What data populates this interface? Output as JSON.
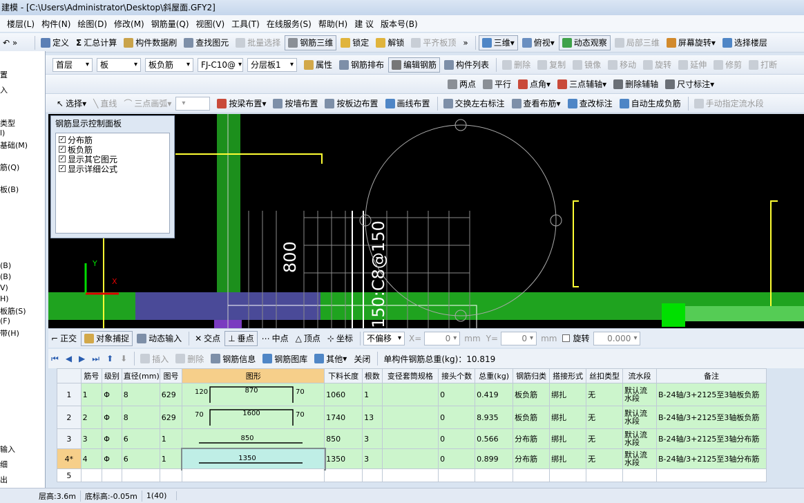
{
  "window": {
    "title": "建模 - [C:\\Users\\Administrator\\Desktop\\斜屋面.GFY2]"
  },
  "menu": [
    "楼层(L)",
    "构件(N)",
    "绘图(D)",
    "修改(M)",
    "钢筋量(Q)",
    "视图(V)",
    "工具(T)",
    "在线服务(S)",
    "帮助(H)",
    "建 议",
    "版本号(B)"
  ],
  "toolbar1": {
    "define": "定义",
    "summary": "汇总计算",
    "brush": "构件数据刷",
    "find": "查找图元",
    "batch": "批量选择",
    "rebar3d": "钢筋三维",
    "lock": "锁定",
    "unlock": "解锁",
    "align": "平齐板顶",
    "view3d": "三维",
    "top": "俯视",
    "dynamic": "动态观察",
    "local3d": "局部三维",
    "rotate": "屏幕旋转",
    "floor_select": "选择楼层"
  },
  "toolbar2": {
    "floor": "首层",
    "type": "板",
    "subtype": "板负筋",
    "component": "FJ-C10@",
    "layer": "分层板1",
    "attr": "属性",
    "arrange": "钢筋排布",
    "edit_rebar": "编辑钢筋",
    "comp_list": "构件列表",
    "delete": "删除",
    "copy": "复制",
    "mirror": "镜像",
    "move": "移动",
    "rotate": "旋转",
    "extend": "延伸",
    "trim": "修剪",
    "break": "打断"
  },
  "toolbar3": {
    "two_point": "两点",
    "parallel": "平行",
    "point_angle": "点角",
    "three_point_aux": "三点辅轴",
    "delete_aux": "删除辅轴",
    "dimension": "尺寸标注"
  },
  "toolbar4": {
    "select": "选择",
    "line": "直线",
    "arc3": "三点画弧",
    "by_beam": "按梁布置",
    "by_wall": "按墙布置",
    "by_slab_edge": "按板边布置",
    "draw_line": "画线布置",
    "swap_labels": "交换左右标注",
    "view_layout": "查看布筋",
    "check_labels": "查改标注",
    "auto_gen": "自动生成负筋",
    "flow_seg": "手动指定流水段"
  },
  "left_panel": {
    "rows": [
      "置",
      "入",
      "类型",
      "l)",
      "基础(M)",
      "筋(Q)",
      "板(B)",
      "(B)",
      "(B)",
      "V)",
      "H)",
      "板筋(S)",
      "(F)",
      "带(H)",
      "输入",
      "细",
      "出"
    ]
  },
  "rebar_panel": {
    "title": "钢筋显示控制面板",
    "options": [
      {
        "label": "分布筋",
        "checked": true
      },
      {
        "label": "板负筋",
        "checked": true
      },
      {
        "label": "显示其它图元",
        "checked": true
      },
      {
        "label": "显示详细公式",
        "checked": true
      }
    ]
  },
  "canvas": {
    "dim_label": "800",
    "rebar_label": "150:C8@150",
    "axis_x": "X",
    "axis_y": "Y"
  },
  "snap_bar": {
    "ortho": "正交",
    "object_snap": "对象捕捉",
    "dynamic_input": "动态输入",
    "intersection": "交点",
    "perpendicular": "垂点",
    "midpoint": "中点",
    "vertex": "顶点",
    "coordinate": "坐标",
    "offset_mode": "不偏移",
    "x_label": "X=",
    "x_value": "0",
    "x_unit": "mm",
    "y_label": "Y=",
    "y_value": "0",
    "y_unit": "mm",
    "rotate_label": "旋转",
    "rotate_value": "0.000"
  },
  "grid_toolbar": {
    "insert": "插入",
    "delete": "删除",
    "rebar_info": "钢筋信息",
    "rebar_library": "钢筋图库",
    "other": "其他",
    "close": "关闭",
    "total_weight": "单构件钢筋总重(kg)：10.819"
  },
  "table": {
    "headers": [
      "筋号",
      "级别",
      "直径(mm)",
      "图号",
      "图形",
      "下料长度",
      "根数",
      "变径套筒规格",
      "接头个数",
      "总重(kg)",
      "钢筋归类",
      "搭接形式",
      "丝扣类型",
      "流水段",
      "备注"
    ],
    "rows": [
      {
        "row_num": "1",
        "cells": [
          "1",
          "Φ",
          "8",
          "629",
          "",
          "1060",
          "1",
          "",
          "0",
          "0.419",
          "板负筋",
          "绑扎",
          "无",
          "默认流水段",
          "B-24轴/3+2125至3轴板负筋"
        ],
        "shape": {
          "left": "120",
          "mid": "870",
          "right": "70"
        }
      },
      {
        "row_num": "2",
        "cells": [
          "2",
          "Φ",
          "8",
          "629",
          "",
          "1740",
          "13",
          "",
          "0",
          "8.935",
          "板负筋",
          "绑扎",
          "无",
          "默认流水段",
          "B-24轴/3+2125至3轴板负筋"
        ],
        "shape": {
          "left": "70",
          "mid": "1600",
          "right": "70"
        }
      },
      {
        "row_num": "3",
        "cells": [
          "3",
          "Φ",
          "6",
          "1",
          "",
          "850",
          "3",
          "",
          "0",
          "0.566",
          "分布筋",
          "绑扎",
          "无",
          "默认流水段",
          "B-24轴/3+2125至3轴分布筋"
        ],
        "shape": {
          "left": "",
          "mid": "850",
          "right": ""
        }
      },
      {
        "row_num": "4*",
        "cells": [
          "4",
          "Φ",
          "6",
          "1",
          "",
          "1350",
          "3",
          "",
          "0",
          "0.899",
          "分布筋",
          "绑扎",
          "无",
          "默认流水段",
          "B-24轴/3+2125至3轴分布筋"
        ],
        "shape": {
          "left": "",
          "mid": "1350",
          "right": ""
        }
      },
      {
        "row_num": "5",
        "cells": [
          "",
          "",
          "",
          "",
          "",
          "",
          "",
          "",
          "",
          "",
          "",
          "",
          "",
          "",
          ""
        ],
        "shape": {
          "left": "",
          "mid": "",
          "right": ""
        }
      }
    ]
  },
  "status_bar": {
    "floor_height": "层高:3.6m",
    "bottom_elev": "底标高:-0.05m",
    "count": "1(40)"
  },
  "colors": {
    "canvas_bg": "#000000",
    "green": "#1fa31f",
    "yellow": "#ffff33",
    "accent": "#f6cf8a"
  }
}
